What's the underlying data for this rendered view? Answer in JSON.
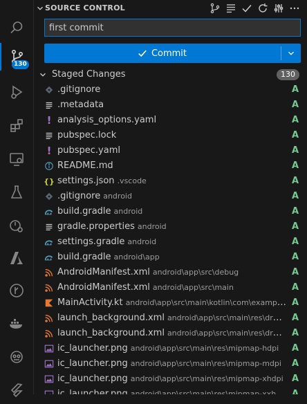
{
  "sidebar": {
    "title": "SOURCE CONTROL",
    "commit_message": "first commit",
    "commit_button": "Commit",
    "staged_label": "Staged Changes",
    "staged_count": "130",
    "scm_badge": "130"
  },
  "colors": {
    "accent": "#0078d4",
    "added": "#73c991",
    "muted_text": "#9d9d9d"
  },
  "files": [
    {
      "name": ".gitignore",
      "dir": "",
      "status": "A",
      "icon": "gitignore-icon"
    },
    {
      "name": ".metadata",
      "dir": "",
      "status": "A",
      "icon": "lines-file-icon"
    },
    {
      "name": "analysis_options.yaml",
      "dir": "",
      "status": "A",
      "icon": "yaml-icon"
    },
    {
      "name": "pubspec.lock",
      "dir": "",
      "status": "A",
      "icon": "lines-file-icon"
    },
    {
      "name": "pubspec.yaml",
      "dir": "",
      "status": "A",
      "icon": "yaml-icon"
    },
    {
      "name": "README.md",
      "dir": "",
      "status": "A",
      "icon": "info-icon"
    },
    {
      "name": "settings.json",
      "dir": ".vscode",
      "status": "A",
      "icon": "json-icon"
    },
    {
      "name": ".gitignore",
      "dir": "android",
      "status": "A",
      "icon": "gitignore-icon"
    },
    {
      "name": "build.gradle",
      "dir": "android",
      "status": "A",
      "icon": "gradle-icon"
    },
    {
      "name": "gradle.properties",
      "dir": "android",
      "status": "A",
      "icon": "lines-file-icon"
    },
    {
      "name": "settings.gradle",
      "dir": "android",
      "status": "A",
      "icon": "gradle-icon"
    },
    {
      "name": "build.gradle",
      "dir": "android\\app",
      "status": "A",
      "icon": "gradle-icon"
    },
    {
      "name": "AndroidManifest.xml",
      "dir": "android\\app\\src\\debug",
      "status": "A",
      "icon": "rss-xml-icon"
    },
    {
      "name": "AndroidManifest.xml",
      "dir": "android\\app\\src\\main",
      "status": "A",
      "icon": "rss-xml-icon"
    },
    {
      "name": "MainActivity.kt",
      "dir": "android\\app\\src\\main\\kotlin\\com\\example\\fo...",
      "status": "A",
      "icon": "kotlin-icon"
    },
    {
      "name": "launch_background.xml",
      "dir": "android\\app\\src\\main\\res\\drawable",
      "status": "A",
      "icon": "rss-xml-icon"
    },
    {
      "name": "launch_background.xml",
      "dir": "android\\app\\src\\main\\res\\drawable...",
      "status": "A",
      "icon": "rss-xml-icon"
    },
    {
      "name": "ic_launcher.png",
      "dir": "android\\app\\src\\main\\res\\mipmap-hdpi",
      "status": "A",
      "icon": "image-icon"
    },
    {
      "name": "ic_launcher.png",
      "dir": "android\\app\\src\\main\\res\\mipmap-mdpi",
      "status": "A",
      "icon": "image-icon"
    },
    {
      "name": "ic_launcher.png",
      "dir": "android\\app\\src\\main\\res\\mipmap-xhdpi",
      "status": "A",
      "icon": "image-icon"
    },
    {
      "name": "ic_launcher.png",
      "dir": "android\\app\\src\\main\\res\\mipmap-xxhdpi",
      "status": "A",
      "icon": "image-icon"
    }
  ]
}
